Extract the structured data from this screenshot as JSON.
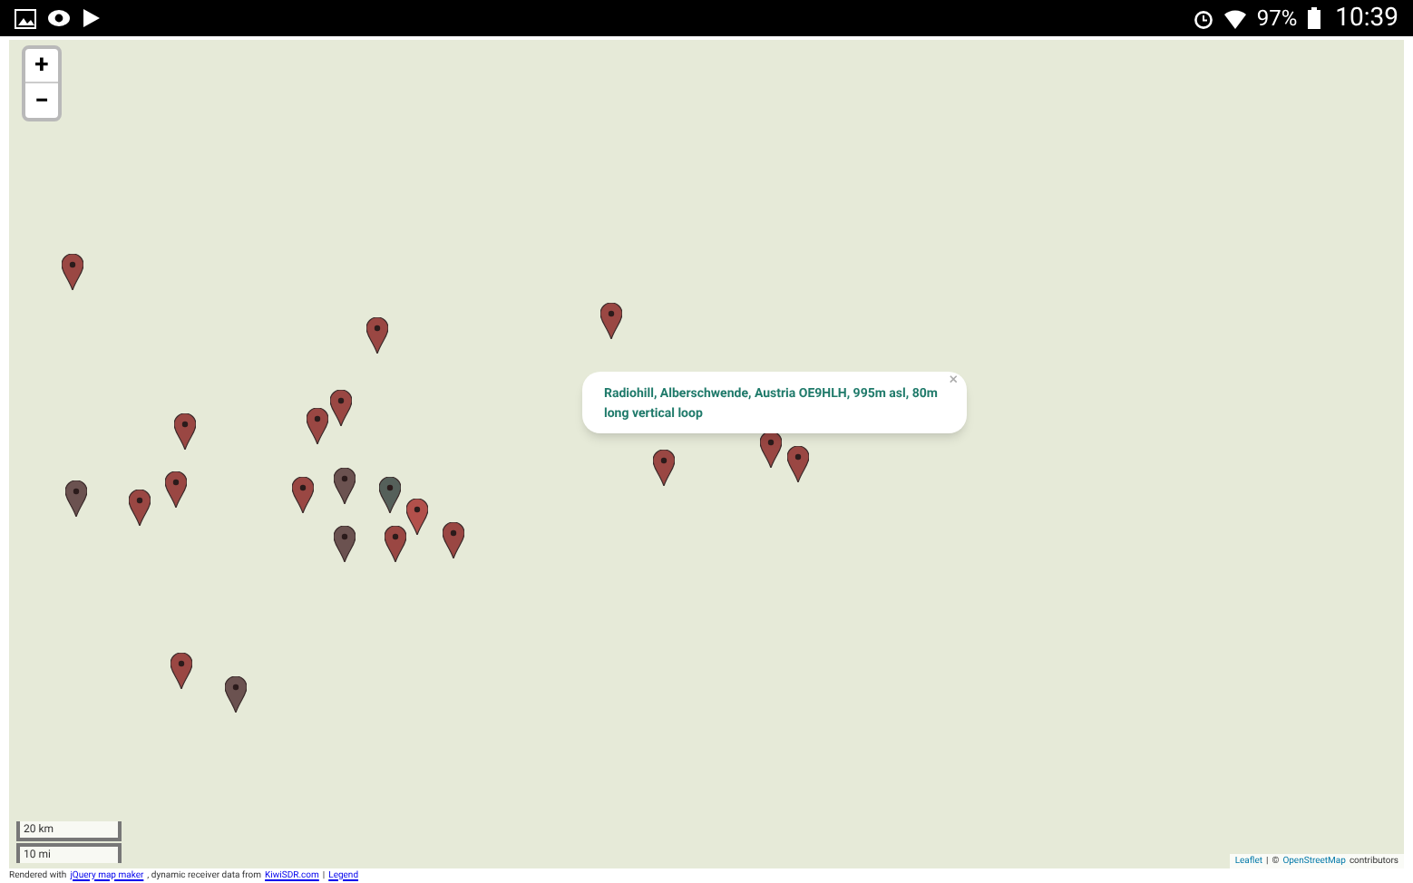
{
  "status_bar": {
    "battery": "97%",
    "time": "10:39"
  },
  "zoom_controls": [
    "+",
    "−"
  ],
  "markers": [
    {
      "color": "#9a4743"
    },
    {
      "color": "#9a4743"
    },
    {
      "color": "#9a4743"
    },
    {
      "color": "#9a4743"
    },
    {
      "color": "#9a4743"
    },
    {
      "color": "#9a4743"
    },
    {
      "color": "#6b5250"
    },
    {
      "color": "#9a4743"
    },
    {
      "color": "#9a4743"
    },
    {
      "color": "#9a4743"
    },
    {
      "color": "#6b5250"
    },
    {
      "color": "#55605a"
    },
    {
      "color": "#b2504b"
    },
    {
      "color": "#6b5250"
    },
    {
      "color": "#9a4743"
    },
    {
      "color": "#9a4743"
    },
    {
      "color": "#9a4743"
    },
    {
      "color": "#9a4743"
    },
    {
      "color": "#9a4743"
    },
    {
      "color": "#9a4743"
    },
    {
      "color": "#6b5250"
    }
  ],
  "popup": {
    "text": "Radiohill, Alberschwende, Austria OE9HLH, 995m asl, 80m long vertical loop",
    "close": "×"
  },
  "scale": [
    "20 km",
    "10 mi"
  ],
  "credits": {
    "prefix": "Rendered with",
    "link1": "jQuery map maker",
    "middle": ", dynamic receiver data from",
    "link2": "KiwiSDR.com",
    "separator": "|",
    "link3": "Legend"
  },
  "attribution": {
    "link1": "Leaflet",
    "separator": "|",
    "copyright": "©",
    "link2": "OpenStreetMap",
    "suffix": "contributors"
  }
}
